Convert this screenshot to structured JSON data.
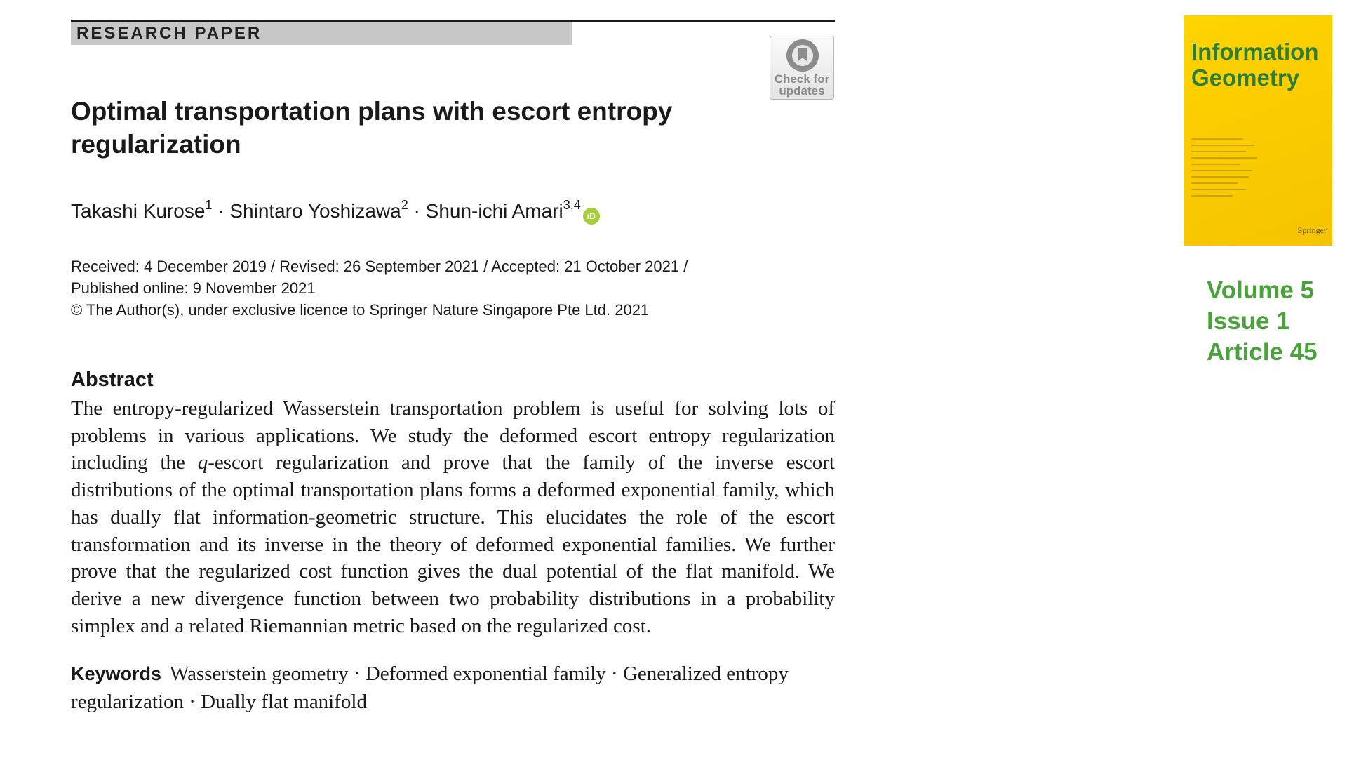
{
  "header": {
    "article_type": "RESEARCH PAPER",
    "check_badge": "Check for updates"
  },
  "paper": {
    "title": "Optimal transportation plans with escort entropy regularization",
    "authors": [
      {
        "name": "Takashi Kurose",
        "affil": "1"
      },
      {
        "name": "Shintaro Yoshizawa",
        "affil": "2"
      },
      {
        "name": "Shun-ichi Amari",
        "affil": "3,4"
      }
    ],
    "author_separator": " · ",
    "dates_line1": "Received: 4 December 2019 / Revised: 26 September 2021 / Accepted: 21 October 2021 /",
    "dates_line2": "Published online: 9 November 2021",
    "copyright": "© The Author(s), under exclusive licence to Springer Nature Singapore Pte Ltd. 2021",
    "abstract_heading": "Abstract",
    "abstract_part1": "The entropy-regularized Wasserstein transportation problem is useful for solving lots of problems in various applications. We study the deformed escort entropy regularization including the ",
    "abstract_q": "q",
    "abstract_part2": "-escort regularization and prove that the family of the inverse escort distributions of the optimal transportation plans forms a deformed exponential family, which has dually flat information-geometric structure. This elucidates the role of the escort transformation and its inverse in the theory of deformed exponential families. We further prove that the regularized cost function gives the dual potential of the flat manifold. We derive a new divergence function between two probability distributions in a probability simplex and a related Riemannian metric based on the regularized cost.",
    "keywords_heading": "Keywords",
    "keywords": "Wasserstein geometry · Deformed exponential family · Generalized entropy regularization · Dually flat manifold"
  },
  "cover": {
    "journal_title": "Information Geometry",
    "publisher": "Springer",
    "cover_color": "#ffd400",
    "title_color": "#2e7d32"
  },
  "issue": {
    "volume": "Volume 5",
    "issue": "Issue 1",
    "article": "Article 45",
    "color": "#4aa33a"
  }
}
